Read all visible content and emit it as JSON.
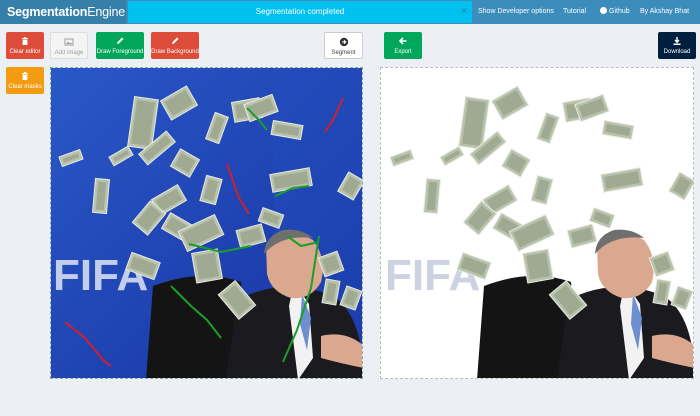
{
  "navbar": {
    "brand_bold": "Segmentation",
    "brand_light": "Engine",
    "alert_text": "Segmentation completed",
    "alert_close": "×",
    "links": {
      "developer": "Show Developer options",
      "tutorial": "Tutorial",
      "github": "Github",
      "author": "By Akshay Bhat"
    }
  },
  "toolbar": {
    "clear_editor": "Clear editor",
    "add_image": "Add image",
    "draw_foreground": "Draw Foreground",
    "draw_background": "Draw Background",
    "segment": "Segment",
    "clear_masks": "Clear masks",
    "export": "Export",
    "download": "Download"
  },
  "image_text": {
    "left_logo": "FIFA",
    "right_logo": "FIFA"
  },
  "colors": {
    "navbar": "#3c8dbc",
    "brand": "#367fa9",
    "alert": "#00c0ef",
    "danger": "#dd4b39",
    "success": "#00a65a",
    "warning": "#f39c12",
    "navy": "#001f3f",
    "foreground_stroke": "#1a9e2a",
    "background_stroke": "#d0202a",
    "canvas_blue": "#1a3fb0"
  },
  "icons": [
    "trash-icon",
    "image-icon",
    "pencil-icon",
    "arrow-circle-right-icon",
    "arrow-left-icon",
    "download-icon",
    "github-icon",
    "close-icon"
  ]
}
